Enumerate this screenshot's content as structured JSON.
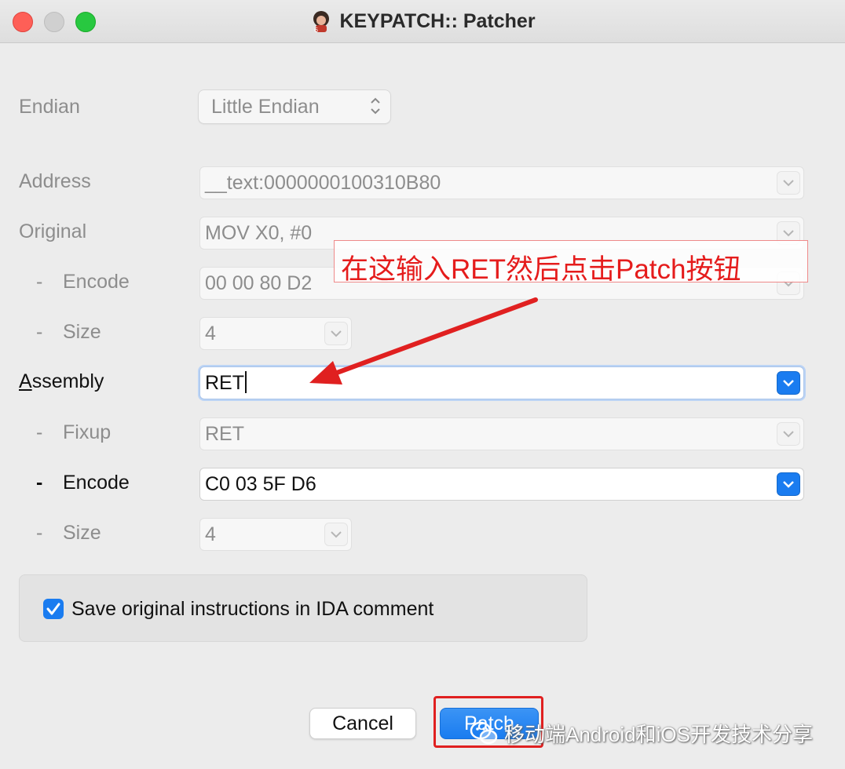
{
  "window": {
    "title": "KEYPATCH:: Patcher"
  },
  "form": {
    "endian": {
      "label": "Endian",
      "value": "Little Endian"
    },
    "address": {
      "label": "Address",
      "value": "__text:0000000100310B80"
    },
    "original": {
      "label": "Original",
      "value": "MOV X0, #0"
    },
    "original_encode": {
      "dash": "-",
      "label": "Encode",
      "value": "00 00 80 D2"
    },
    "original_size": {
      "dash": "-",
      "label": "Size",
      "value": "4"
    },
    "assembly": {
      "label_first": "A",
      "label_rest": "ssembly",
      "value": "RET"
    },
    "fixup": {
      "dash": "-",
      "label": "Fixup",
      "value": "RET"
    },
    "new_encode": {
      "dash": "-",
      "label": "Encode",
      "value": "C0 03 5F D6"
    },
    "new_size": {
      "dash": "-",
      "label": "Size",
      "value": "4"
    }
  },
  "options": {
    "save_comment_label": "Save original instructions in IDA comment",
    "save_comment_checked": true
  },
  "buttons": {
    "cancel": "Cancel",
    "patch": "Patch"
  },
  "annotation": {
    "text": "在这输入RET然后点击Patch按钮",
    "color": "#e51c1c"
  },
  "watermark": {
    "text": "移动端Android和iOS开发技术分享"
  },
  "colors": {
    "accent": "#1a7cf0",
    "close": "#fe5f57",
    "zoom": "#28c840"
  }
}
